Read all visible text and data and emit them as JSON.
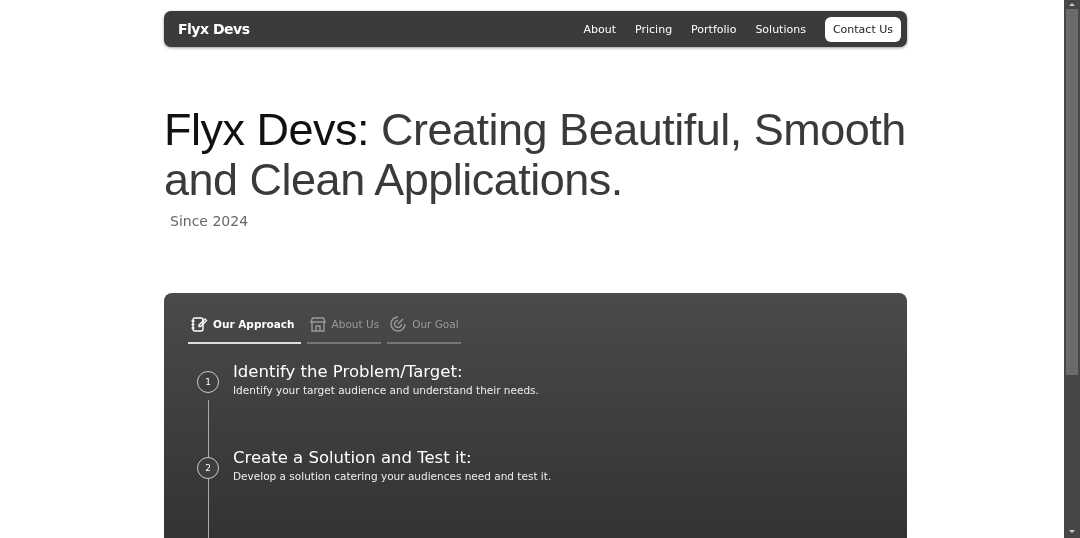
{
  "nav": {
    "brand": "Flyx Devs",
    "links": [
      "About",
      "Pricing",
      "Portfolio",
      "Solutions"
    ],
    "cta": "Contact Us"
  },
  "hero": {
    "lead": "Flyx Devs:",
    "headline": " Creating Beautiful, Smooth and Clean Applications.",
    "since": "Since 2024"
  },
  "tabs": [
    {
      "label": "Our Approach",
      "kind": "notebook",
      "selected": true
    },
    {
      "label": "About Us",
      "kind": "store",
      "selected": false
    },
    {
      "label": "Our Goal",
      "kind": "target",
      "selected": false
    }
  ],
  "steps": [
    {
      "number": "1",
      "title": "Identify the Problem/Target:",
      "text": "Identify your target audience and understand their needs."
    },
    {
      "number": "2",
      "title": "Create a Solution and Test it:",
      "text": "Develop a solution catering your audiences need and test it."
    }
  ]
}
